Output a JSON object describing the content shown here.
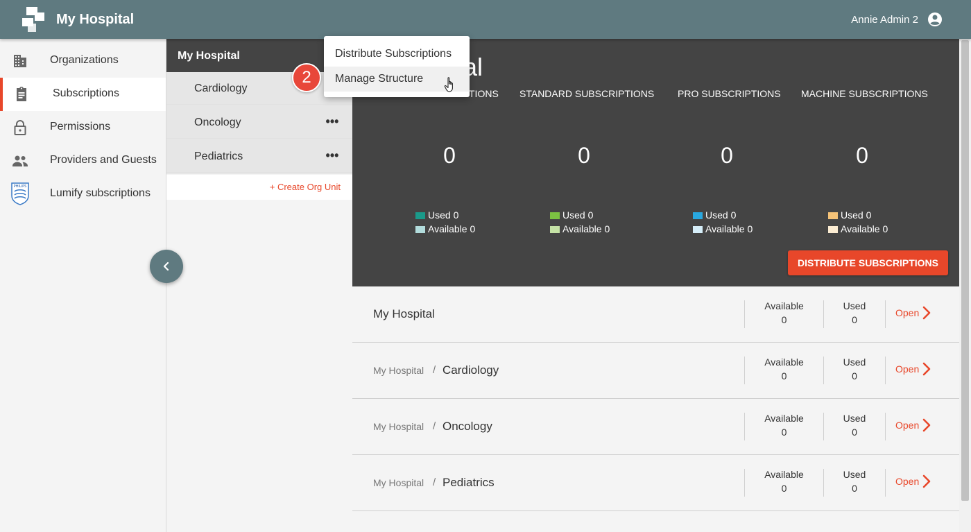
{
  "header": {
    "app_title": "My Hospital",
    "user_name": "Annie Admin 2"
  },
  "sidebar": {
    "items": [
      {
        "label": "Organizations",
        "icon": "building-icon"
      },
      {
        "label": "Subscriptions",
        "icon": "clipboard-icon",
        "active": true
      },
      {
        "label": "Permissions",
        "icon": "lock-icon"
      },
      {
        "label": "Providers and Guests",
        "icon": "people-icon"
      },
      {
        "label": "Lumify subscriptions",
        "icon": "philips-shield-icon"
      }
    ]
  },
  "tree": {
    "root": "My Hospital",
    "children": [
      "Cardiology",
      "Oncology",
      "Pediatrics"
    ],
    "more_glyph": "•••",
    "create_label": "+ Create Org Unit"
  },
  "context_menu": {
    "items": [
      "Distribute Subscriptions",
      "Manage Structure"
    ],
    "hovered": "Manage Structure",
    "step_badge": "2"
  },
  "summary": {
    "title_visible": "tal",
    "columns": [
      {
        "heading": "TIONS",
        "total": "0",
        "used_label": "Used 0",
        "available_label": "Available 0",
        "used_color": "#1a9a8a",
        "available_color": "#b2dcdc"
      },
      {
        "heading": "STANDARD SUBSCRIPTIONS",
        "total": "0",
        "used_label": "Used 0",
        "available_label": "Available 0",
        "used_color": "#7cc242",
        "available_color": "#c5e3a6"
      },
      {
        "heading": "PRO SUBSCRIPTIONS",
        "total": "0",
        "used_label": "Used 0",
        "available_label": "Available 0",
        "used_color": "#29a8e0",
        "available_color": "#d6eef9"
      },
      {
        "heading": "MACHINE SUBSCRIPTIONS",
        "total": "0",
        "used_label": "Used 0",
        "available_label": "Available 0",
        "used_color": "#f5c378",
        "available_color": "#fbecd2"
      }
    ],
    "distribute_button": "DISTRIBUTE SUBSCRIPTIONS"
  },
  "rows": [
    {
      "parent": "",
      "title": "My Hospital",
      "available_label": "Available",
      "available": "0",
      "used_label": "Used",
      "used": "0",
      "open_label": "Open"
    },
    {
      "parent": "My Hospital",
      "separator": "/",
      "title": "Cardiology",
      "available_label": "Available",
      "available": "0",
      "used_label": "Used",
      "used": "0",
      "open_label": "Open"
    },
    {
      "parent": "My Hospital",
      "separator": "/",
      "title": "Oncology",
      "available_label": "Available",
      "available": "0",
      "used_label": "Used",
      "used": "0",
      "open_label": "Open"
    },
    {
      "parent": "My Hospital",
      "separator": "/",
      "title": "Pediatrics",
      "available_label": "Available",
      "available": "0",
      "used_label": "Used",
      "used": "0",
      "open_label": "Open"
    }
  ],
  "colors": {
    "header": "#5f7a80",
    "accent": "#e8472a",
    "panel_dark": "#444444"
  }
}
